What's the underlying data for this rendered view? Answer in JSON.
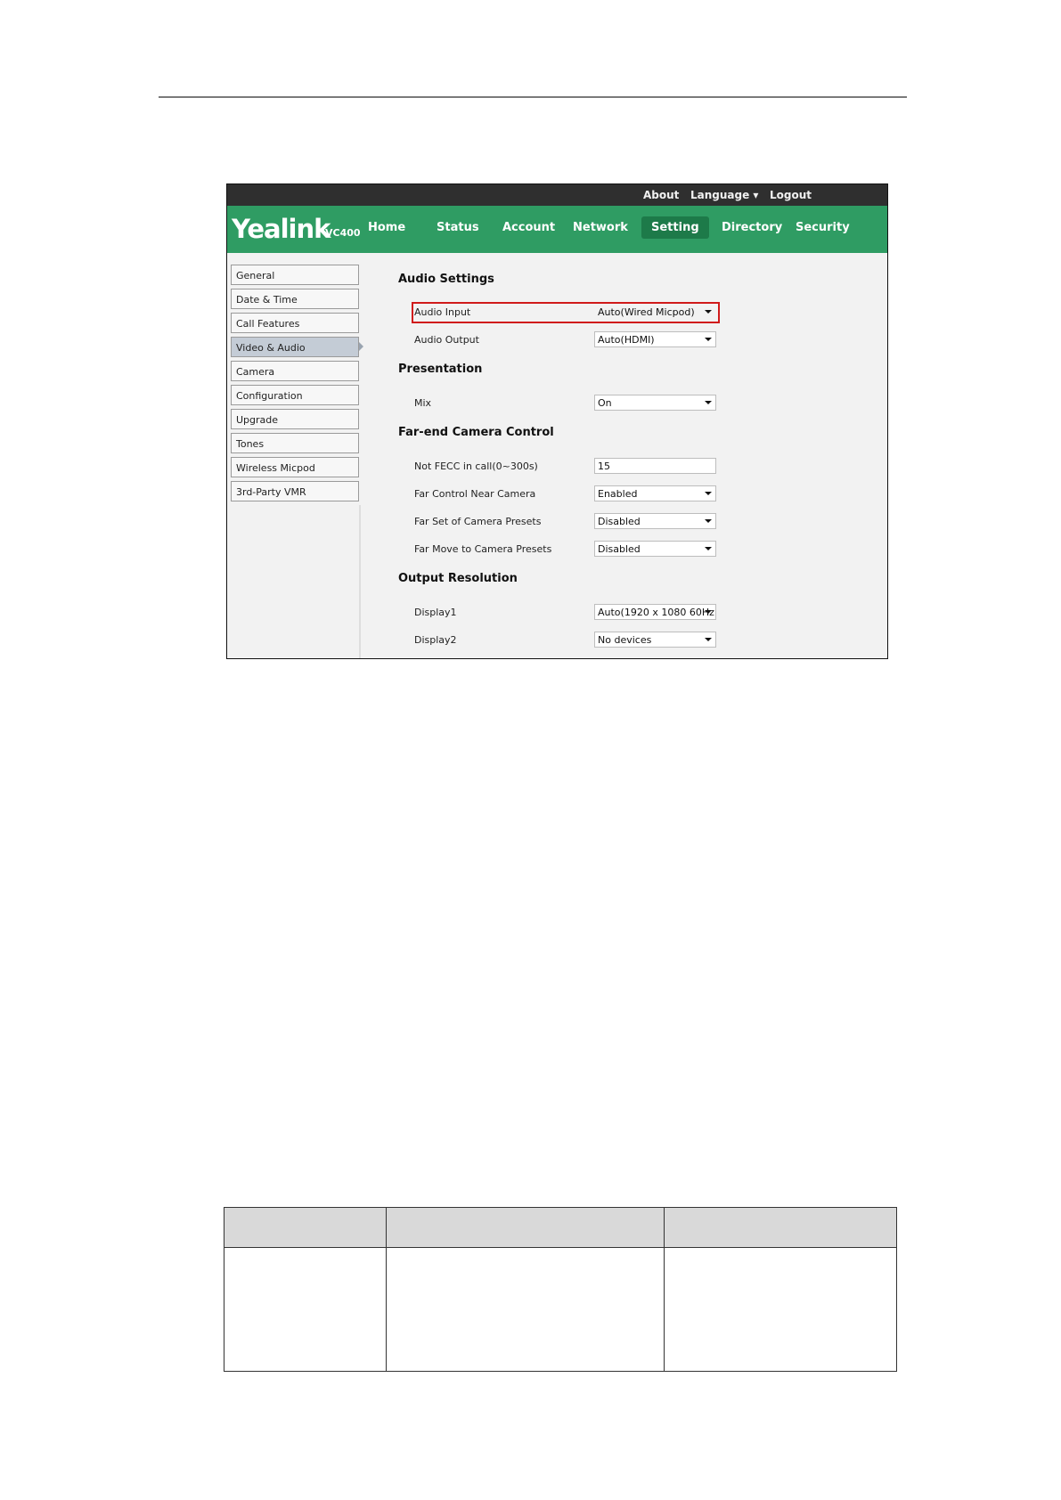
{
  "topbar": {
    "about": "About",
    "language": "Language ▾",
    "logout": "Logout"
  },
  "logo": {
    "brand": "Yealink",
    "model": "VC400"
  },
  "nav": {
    "home": "Home",
    "status": "Status",
    "account": "Account",
    "network": "Network",
    "setting": "Setting",
    "directory": "Directory",
    "security": "Security"
  },
  "sidebar": {
    "items": [
      "General",
      "Date & Time",
      "Call Features",
      "Video & Audio",
      "Camera",
      "Configuration",
      "Upgrade",
      "Tones",
      "Wireless Micpod",
      "3rd-Party VMR"
    ],
    "active": "Video & Audio"
  },
  "audio": {
    "title": "Audio Settings",
    "input_label": "Audio Input",
    "input_value": "Auto(Wired Micpod)",
    "output_label": "Audio Output",
    "output_value": "Auto(HDMI)"
  },
  "presentation": {
    "title": "Presentation",
    "mix_label": "Mix",
    "mix_value": "On"
  },
  "fecc": {
    "title": "Far-end Camera Control",
    "not_fecc_label": "Not FECC in call(0~300s)",
    "not_fecc_value": "15",
    "far_control_label": "Far Control Near Camera",
    "far_control_value": "Enabled",
    "far_set_label": "Far Set of Camera Presets",
    "far_set_value": "Disabled",
    "far_move_label": "Far Move to Camera Presets",
    "far_move_value": "Disabled"
  },
  "output": {
    "title": "Output Resolution",
    "display1_label": "Display1",
    "display1_value": "Auto(1920 x 1080 60Hz",
    "display2_label": "Display2",
    "display2_value": "No devices"
  },
  "colors": {
    "nav_green": "#2f9c63",
    "active_green": "#1d7a49",
    "highlight": "#d01a1a"
  }
}
